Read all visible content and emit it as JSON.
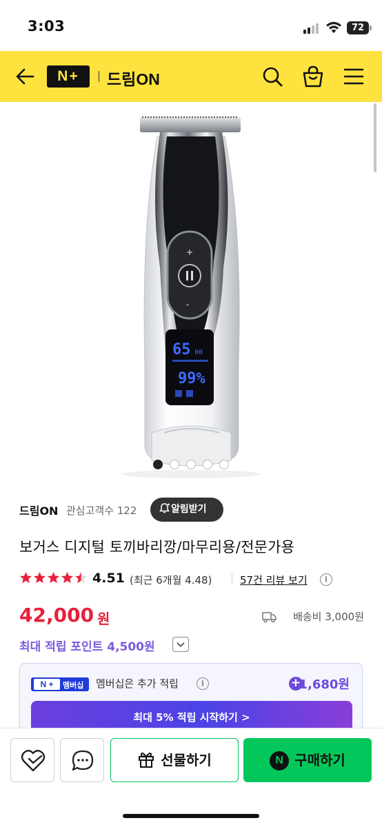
{
  "status_bar": {
    "time": "3:03",
    "battery": "72"
  },
  "header": {
    "logo": "N+",
    "store_name": "드림ON",
    "icons": [
      "back-arrow-icon",
      "search-icon",
      "shopping-bag-icon",
      "menu-icon"
    ],
    "background": "#fee23e"
  },
  "product": {
    "image": {
      "total": 5,
      "current": 1
    },
    "store": {
      "name": "드림ON",
      "fav_label": "관심고객수 122",
      "notify_label": "알림받기"
    },
    "title": "보거스 디지털 토끼바리깡/마무리용/전문가용",
    "rating": {
      "stars": 4.5,
      "value": "4.51",
      "recent": "(최근 6개월 4.48)",
      "review_link": "57건 리뷰 보기"
    },
    "price": {
      "amount": "42,000",
      "unit": "원",
      "shipping": "배송비 3,000원"
    },
    "points": "최대 적립 포인트 4,500원",
    "membership": {
      "badge_plus": "N +",
      "badge_label": "멤버십",
      "text": "멤버십은 추가 적립",
      "points": "1,680원",
      "cta": "최대 5% 적립 시작하기 >"
    }
  },
  "bottom_bar": {
    "gift_label": "선물하기",
    "buy_label": "구매하기",
    "buy_logo": "N"
  },
  "colors": {
    "accent_yellow": "#fee23e",
    "price_red": "#e8203a",
    "points_purple": "#7b5bdb",
    "naver_green": "#03c75a"
  }
}
